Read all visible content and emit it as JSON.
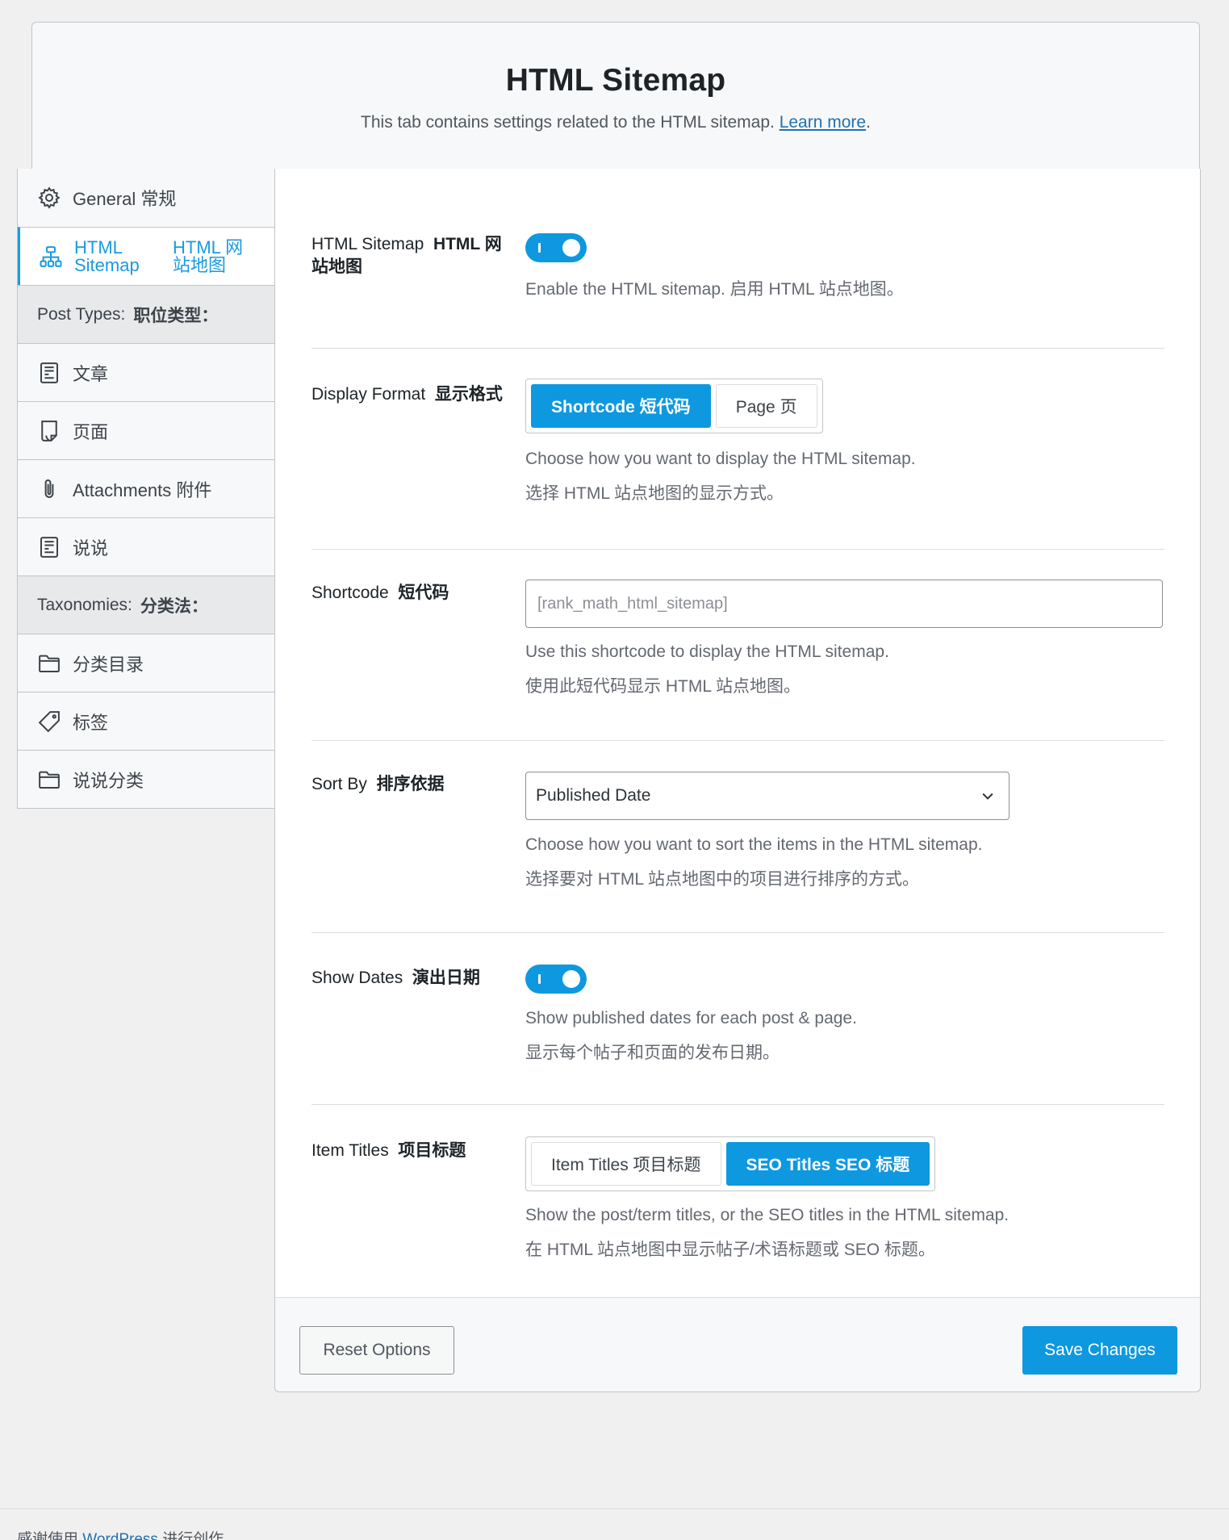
{
  "header": {
    "title": "HTML Sitemap",
    "description": "This tab contains settings related to the HTML sitemap.",
    "learn_more": "Learn more",
    "period": "."
  },
  "sidebar": {
    "items": [
      {
        "label": "General  常规",
        "icon": "gear-icon"
      },
      {
        "label_a": "HTML Sitemap",
        "label_b": "HTML 网站地图",
        "icon": "sitemap-icon"
      },
      {
        "section_en": "Post Types:",
        "section_zh": "职位类型："
      },
      {
        "label": "文章",
        "icon": "document-icon"
      },
      {
        "label": "页面",
        "icon": "page-icon"
      },
      {
        "label": "Attachments  附件",
        "icon": "paperclip-icon"
      },
      {
        "label": "说说",
        "icon": "document-icon"
      },
      {
        "section_en": "Taxonomies:",
        "section_zh": "分类法："
      },
      {
        "label": "分类目录",
        "icon": "folder-icon"
      },
      {
        "label": "标签",
        "icon": "tag-icon"
      },
      {
        "label": "说说分类",
        "icon": "folder-icon"
      }
    ]
  },
  "settings": {
    "html_sitemap": {
      "label_en": "HTML Sitemap",
      "label_zh": "HTML 网站地图",
      "enabled": true,
      "desc": "Enable the HTML sitemap.  启用 HTML 站点地图。"
    },
    "display_format": {
      "label_en": "Display Format",
      "label_zh": "显示格式",
      "options": [
        "Shortcode  短代码",
        "Page  页"
      ],
      "selected": "Shortcode  短代码",
      "desc_en": "Choose how you want to display the HTML sitemap.",
      "desc_zh": "选择 HTML 站点地图的显示方式。"
    },
    "shortcode": {
      "label_en": "Shortcode",
      "label_zh": "短代码",
      "value": "[rank_math_html_sitemap]",
      "desc_en": "Use this shortcode to display the HTML sitemap.",
      "desc_zh": "使用此短代码显示 HTML 站点地图。"
    },
    "sort_by": {
      "label_en": "Sort By",
      "label_zh": "排序依据",
      "value": "Published Date",
      "desc_en": "Choose how you want to sort the items in the HTML sitemap.",
      "desc_zh": "选择要对 HTML 站点地图中的项目进行排序的方式。"
    },
    "show_dates": {
      "label_en": "Show Dates",
      "label_zh": "演出日期",
      "enabled": true,
      "desc_en": "Show published dates for each post & page.",
      "desc_zh": "显示每个帖子和页面的发布日期。"
    },
    "item_titles": {
      "label_en": "Item Titles",
      "label_zh": "项目标题",
      "options": [
        "Item Titles  项目标题",
        "SEO Titles  SEO 标题"
      ],
      "selected": "SEO Titles  SEO 标题",
      "desc_en": "Show the post/term titles, or the SEO titles in the HTML sitemap.",
      "desc_zh": "在 HTML 站点地图中显示帖子/术语标题或 SEO 标题。"
    }
  },
  "buttons": {
    "reset": "Reset Options",
    "save": "Save Changes"
  },
  "footer": {
    "prefix": "感谢使用",
    "link": "WordPress",
    "suffix": "进行创作"
  },
  "colors": {
    "accent": "#0e98e0",
    "link": "#2271b1"
  }
}
